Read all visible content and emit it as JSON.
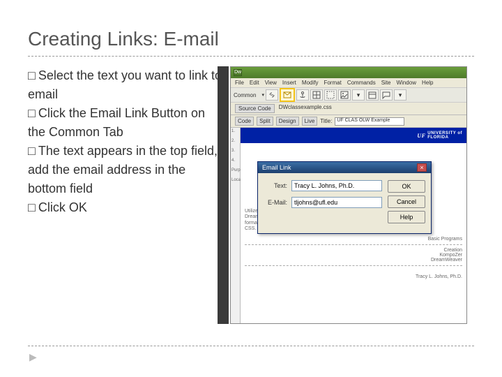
{
  "title": "Creating Links: E-mail",
  "bullets": [
    "Select the text you want to link to email",
    "Click the Email Link Button on the Common Tab",
    "The text appears in the top field, add the email address in the bottom field",
    "Click OK"
  ],
  "dw": {
    "logo": "Dw",
    "menu": [
      "File",
      "Edit",
      "View",
      "Insert",
      "Modify",
      "Format",
      "Commands",
      "Site",
      "Window",
      "Help"
    ],
    "insert_category": "Common",
    "doc_tab": "DWclassexample.css",
    "codebar": {
      "src": "Source Code",
      "doc": "DWclassexample.css"
    },
    "toolbar": {
      "code": "Code",
      "split": "Split",
      "design": "Design",
      "live": "Live",
      "title_label": "Title:",
      "title_value": "UF CLAS OLW Example"
    },
    "ruler": [
      "1.",
      "2.",
      "3.",
      "4."
    ],
    "sidebar_items": [
      "Purpose",
      "Location"
    ],
    "uf_label": "UNIVERSITY of\nFLORIDA",
    "bodytext": "Utilize the more basic shareware c\nDreamweaver, offers a number of\nformats and easier access to coor\nCSS.",
    "programs_label": "Basic Programs",
    "programs": [
      "Creation",
      "KompoZer",
      "DreamWeaver"
    ],
    "author": "Tracy L. Johns, Ph.D."
  },
  "dialog": {
    "title": "Email Link",
    "text_label": "Text:",
    "text_value": "Tracy L. Johns, Ph.D.",
    "email_label": "E-Mail:",
    "email_value": "tljohns@ufl.edu",
    "ok": "OK",
    "cancel": "Cancel",
    "help": "Help"
  }
}
